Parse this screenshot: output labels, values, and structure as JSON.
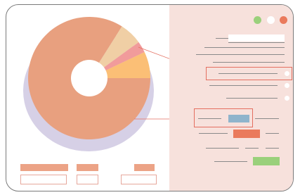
{
  "colors": {
    "panel_bg": "#f7e1dc",
    "pie_main": "#e8a07f",
    "pie_yellow": "#fbbf76",
    "pie_pink": "#f19b9b",
    "pie_beige": "#f0cfa5",
    "pie_shadow": "#d6d0e6",
    "accent_red": "#e46f60",
    "blue_block": "#8fb4cc",
    "orange_block": "#ea7a5c",
    "green_block": "#9ad07b",
    "bottom_bar": "#eca386",
    "dot_green": "#9ad07b",
    "dot_white": "#ffffff",
    "dot_red": "#ea7a5c"
  },
  "chart_data": {
    "type": "pie",
    "values": [
      84,
      7,
      3,
      6
    ]
  }
}
